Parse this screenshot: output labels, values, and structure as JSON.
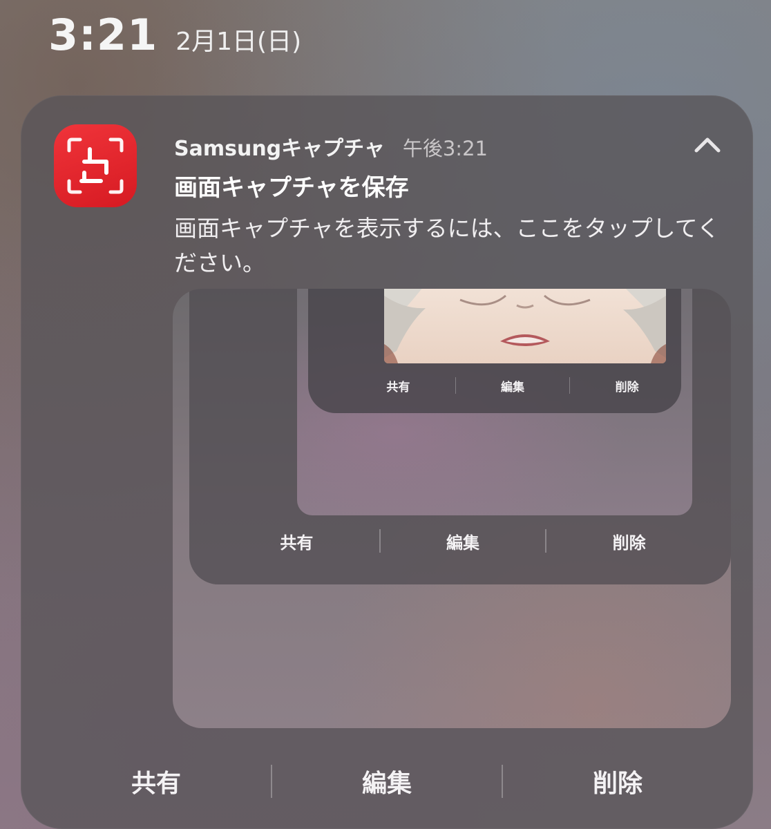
{
  "status_bar": {
    "time": "3:21",
    "date": "2月1日(日)"
  },
  "notification": {
    "app_icon": "screen-capture-icon",
    "app_name": "Samsungキャプチャ",
    "time": "午後3:21",
    "collapse_icon": "chevron-up-icon",
    "title": "画面キャプチャを保存",
    "body": "画面キャプチャを表示するには、ここをタップしてください。",
    "actions": [
      "共有",
      "編集",
      "削除"
    ],
    "accent_color": "#e0242b"
  },
  "preview": {
    "actions_mid": [
      "共有",
      "編集",
      "削除"
    ],
    "actions_small": [
      "共有",
      "編集",
      "削除"
    ]
  }
}
